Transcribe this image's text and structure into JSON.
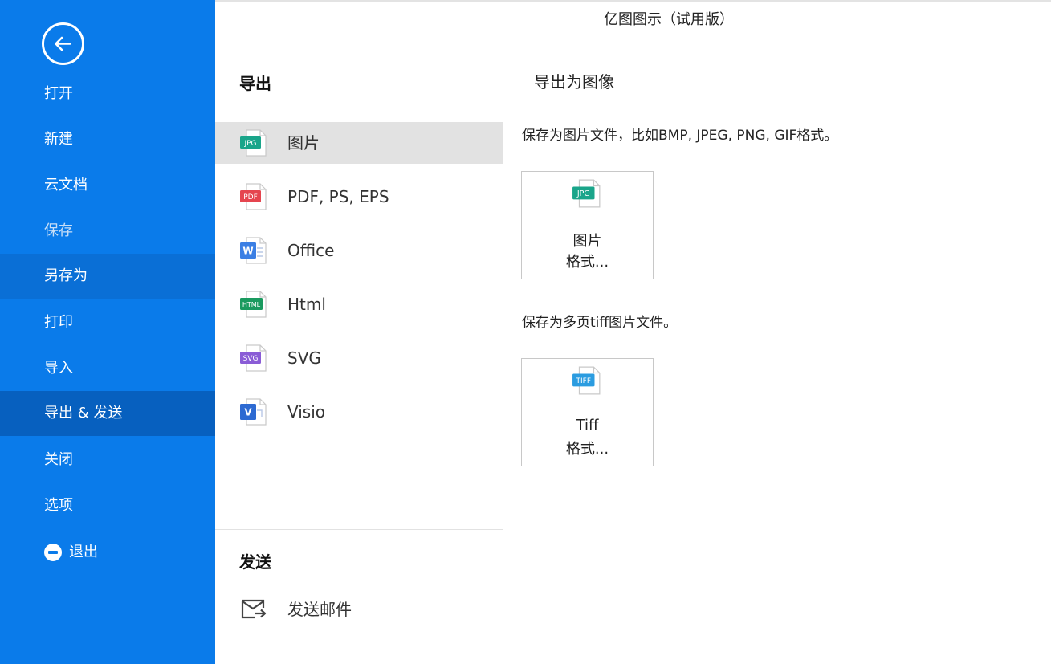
{
  "window": {
    "title": "亿图图示（试用版）"
  },
  "sidebar": {
    "items": [
      {
        "label": "打开",
        "state": "normal"
      },
      {
        "label": "新建",
        "state": "normal"
      },
      {
        "label": "云文档",
        "state": "normal"
      },
      {
        "label": "保存",
        "state": "disabled"
      },
      {
        "label": "另存为",
        "state": "hover"
      },
      {
        "label": "打印",
        "state": "normal"
      },
      {
        "label": "导入",
        "state": "normal"
      },
      {
        "label": "导出 & 发送",
        "state": "selected"
      },
      {
        "label": "关闭",
        "state": "normal"
      },
      {
        "label": "选项",
        "state": "normal"
      },
      {
        "label": "退出",
        "state": "normal",
        "icon": "minus-circle-icon"
      }
    ]
  },
  "export": {
    "heading": "导出",
    "items": [
      {
        "label": "图片",
        "icon": "jpg-file-icon",
        "badge": "JPG",
        "selected": true
      },
      {
        "label": "PDF, PS, EPS",
        "icon": "pdf-file-icon",
        "badge": "PDF",
        "selected": false
      },
      {
        "label": "Office",
        "icon": "word-file-icon",
        "badge": "W",
        "selected": false
      },
      {
        "label": "Html",
        "icon": "html-file-icon",
        "badge": "HTML",
        "selected": false
      },
      {
        "label": "SVG",
        "icon": "svg-file-icon",
        "badge": "SVG",
        "selected": false
      },
      {
        "label": "Visio",
        "icon": "visio-file-icon",
        "badge": "V",
        "selected": false
      }
    ]
  },
  "send": {
    "heading": "发送",
    "email_label": "发送邮件",
    "email_icon": "mail-send-icon"
  },
  "panel": {
    "title": "导出为图像",
    "image_desc": "保存为图片文件，比如BMP, JPEG, PNG, GIF格式。",
    "image_card": {
      "line1": "图片",
      "line2": "格式...",
      "badge": "JPG"
    },
    "tiff_desc": "保存为多页tiff图片文件。",
    "tiff_card": {
      "line1": "Tiff",
      "line2": "格式...",
      "badge": "TIFF"
    }
  },
  "colors": {
    "sidebar": "#0a7bea",
    "sidebar_selected": "#0760bf",
    "jpg": "#1aa58a",
    "pdf": "#e5454f",
    "word": "#3b7fe4",
    "html": "#1a9a5f",
    "svg": "#8a5cd6",
    "visio": "#2d6ad2",
    "tiff": "#2b9ce0"
  }
}
